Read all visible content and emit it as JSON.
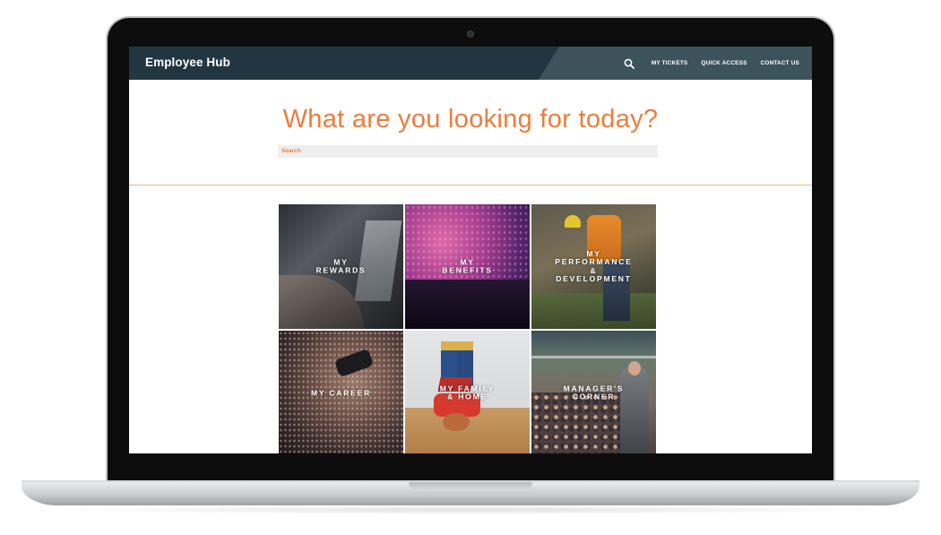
{
  "header": {
    "brand": "Employee Hub",
    "nav": [
      {
        "label": "MY TICKETS"
      },
      {
        "label": "QUICK ACCESS"
      },
      {
        "label": "CONTACT US"
      }
    ],
    "search_icon": "search-icon"
  },
  "hero": {
    "title": "What are you looking for today?",
    "search_placeholder": "Search"
  },
  "tiles": [
    {
      "label": "MY\nREWARDS"
    },
    {
      "label": "MY\nBENEFITS"
    },
    {
      "label": "MY\nPERFORMANCE\n&\nDEVELOPMENT"
    },
    {
      "label": "MY CAREER"
    },
    {
      "label": "MY FAMILY\n& HOME"
    },
    {
      "label": "MANAGER'S\nCORNER"
    }
  ],
  "colors": {
    "accent": "#ef7c3b",
    "navbar": "#213641",
    "divider": "#f4b690"
  }
}
